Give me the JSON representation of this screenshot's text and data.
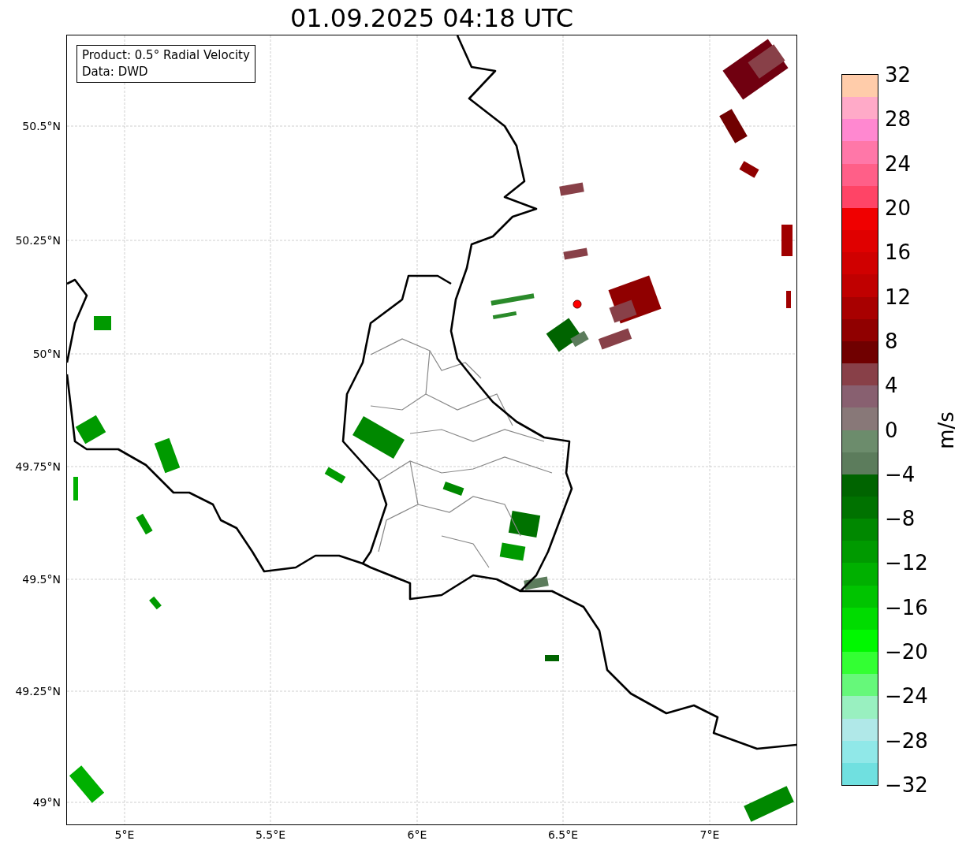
{
  "title": "01.09.2025 04:18 UTC",
  "info_box": {
    "lines": [
      "Product: 0.5° Radial Velocity",
      "Data: DWD"
    ]
  },
  "map": {
    "lat_labels": [
      "50.5°N",
      "50.25°N",
      "50°N",
      "49.75°N",
      "49.5°N",
      "49.25°N",
      "49°N"
    ],
    "lon_labels": [
      "5°E",
      "5.5°E",
      "6°E",
      "6.5°E",
      "7°E"
    ]
  },
  "colorbar": {
    "label": "m/s",
    "ticks": [
      "32",
      "28",
      "24",
      "20",
      "16",
      "12",
      "8",
      "4",
      "0",
      "−4",
      "−8",
      "−12",
      "−16",
      "−20",
      "−24",
      "−28",
      "−32"
    ],
    "segments": [
      {
        "color": "#ffccaa"
      },
      {
        "color": "#ffaac8"
      },
      {
        "color": "#ff88d0"
      },
      {
        "color": "#ff77a8"
      },
      {
        "color": "#ff5f88"
      },
      {
        "color": "#ff4466"
      },
      {
        "color": "#f00000"
      },
      {
        "color": "#e00000"
      },
      {
        "color": "#d00000"
      },
      {
        "color": "#c00000"
      },
      {
        "color": "#a80000"
      },
      {
        "color": "#900000"
      },
      {
        "color": "#700000"
      },
      {
        "color": "#884048"
      },
      {
        "color": "#886070"
      },
      {
        "color": "#887878"
      },
      {
        "color": "#6c8c6c"
      },
      {
        "color": "#5c7c5c"
      },
      {
        "color": "#006400"
      },
      {
        "color": "#007200"
      },
      {
        "color": "#008800"
      },
      {
        "color": "#009a00"
      },
      {
        "color": "#00b000"
      },
      {
        "color": "#00c400"
      },
      {
        "color": "#00dc00"
      },
      {
        "color": "#00f800"
      },
      {
        "color": "#33ff33"
      },
      {
        "color": "#66f87a"
      },
      {
        "color": "#99f0c0"
      },
      {
        "color": "#b0e8e8"
      },
      {
        "color": "#90e8e8"
      },
      {
        "color": "#70e0e0"
      }
    ]
  }
}
